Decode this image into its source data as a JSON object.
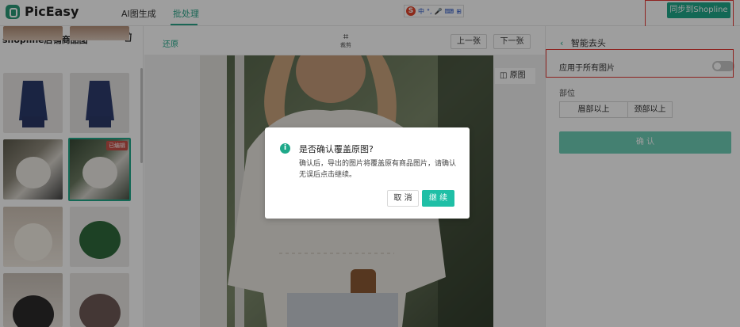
{
  "app": {
    "logo_text": "PicEasy",
    "nav": [
      "AI图生成",
      "批处理"
    ],
    "active_nav": "批处理",
    "sync_button": "同步到Shopline",
    "ime_chars": [
      "中",
      "°,",
      "🎤",
      "⌨",
      "⊞"
    ]
  },
  "left_panel": {
    "title": "shopline店铺商品图",
    "refresh_icon": "refresh-icon",
    "delete_icon": "trash-icon",
    "edited_badge": "已编辑"
  },
  "editor": {
    "restore": "还原",
    "crop_label": "裁剪",
    "prev": "上一张",
    "next": "下一张",
    "original": "原图"
  },
  "right_panel": {
    "title": "智能去头",
    "apply_all": "应用于所有图片",
    "apply_all_on": false,
    "part_label": "部位",
    "segments": [
      "眉部以上",
      "颈部以上"
    ],
    "confirm": "确 认"
  },
  "dialog": {
    "title": "是否确认覆盖原图?",
    "body": "确认后，导出的图片将覆盖原有商品图片，请确认无误后点击继续。",
    "cancel": "取 消",
    "continue": "继 续"
  },
  "colors": {
    "accent": "#1fa98a",
    "highlight": "#e53935"
  }
}
